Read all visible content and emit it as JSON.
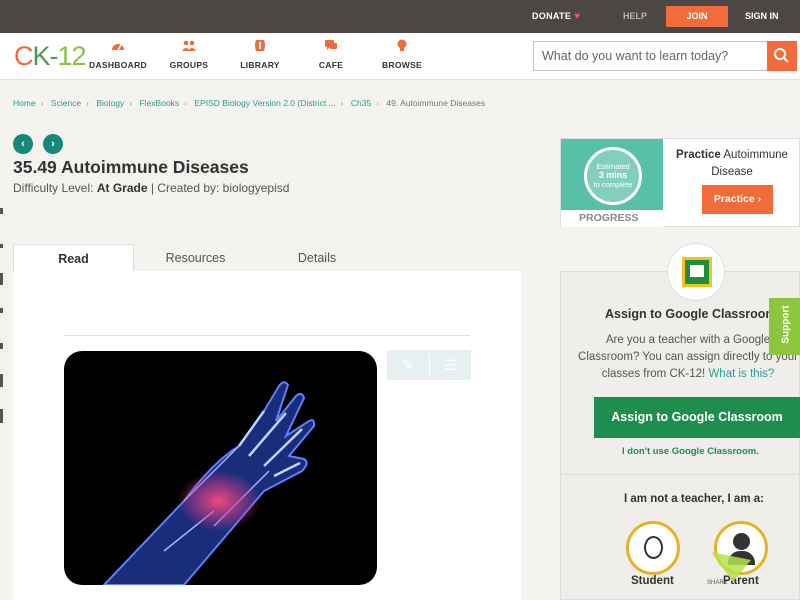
{
  "topbar": {
    "donate": "DONATE",
    "help": "HELP",
    "join": "JOIN",
    "signin": "SIGN IN"
  },
  "logo": {
    "c": "C",
    "k": "K",
    "dash": "-",
    "n": "12"
  },
  "nav": {
    "items": [
      {
        "label": "DASHBOARD",
        "icon": "dashboard-icon"
      },
      {
        "label": "GROUPS",
        "icon": "groups-icon"
      },
      {
        "label": "LIBRARY",
        "icon": "library-icon"
      },
      {
        "label": "CAFE",
        "icon": "cafe-icon"
      },
      {
        "label": "BROWSE",
        "icon": "browse-icon"
      }
    ],
    "search_placeholder": "What do you want to learn today?"
  },
  "breadcrumb": [
    "Home",
    "Science",
    "Biology",
    "FlexBooks",
    "EPISD Biology Version 2.0 (District ...",
    "Ch35",
    "49. Autoimmune Diseases"
  ],
  "page": {
    "title": "35.49 Autoimmune Diseases",
    "difficulty_label": "Difficulty Level:",
    "difficulty": "At Grade",
    "created_by": "| Created by: biologyepisd"
  },
  "tabs": [
    "Read",
    "Resources",
    "Details"
  ],
  "practice": {
    "estimated": "Estimated",
    "mins": "3 mins",
    "complete": "to complete",
    "progress": "PROGRESS",
    "title_bold": "Practice",
    "title_rest": "Autoimmune Disease",
    "button": "Practice"
  },
  "assign": {
    "title": "Assign to Google Classroom",
    "desc1": "Are you a teacher with a Google",
    "desc2": "Classroom? You can assign directly to your",
    "desc3": "classes from CK-12!",
    "link": "What is this?",
    "button": "Assign to Google Classroom",
    "no": "I don't use Google Classroom.",
    "role_prompt": "I am not a teacher, I am a:",
    "student": "Student",
    "parent": "Parent"
  },
  "support": "Support",
  "share": "SHARE",
  "colors": {
    "accent": "#f26b3a",
    "teal": "#16877a",
    "green": "#1e8e4e",
    "topbar": "#4a4744"
  }
}
